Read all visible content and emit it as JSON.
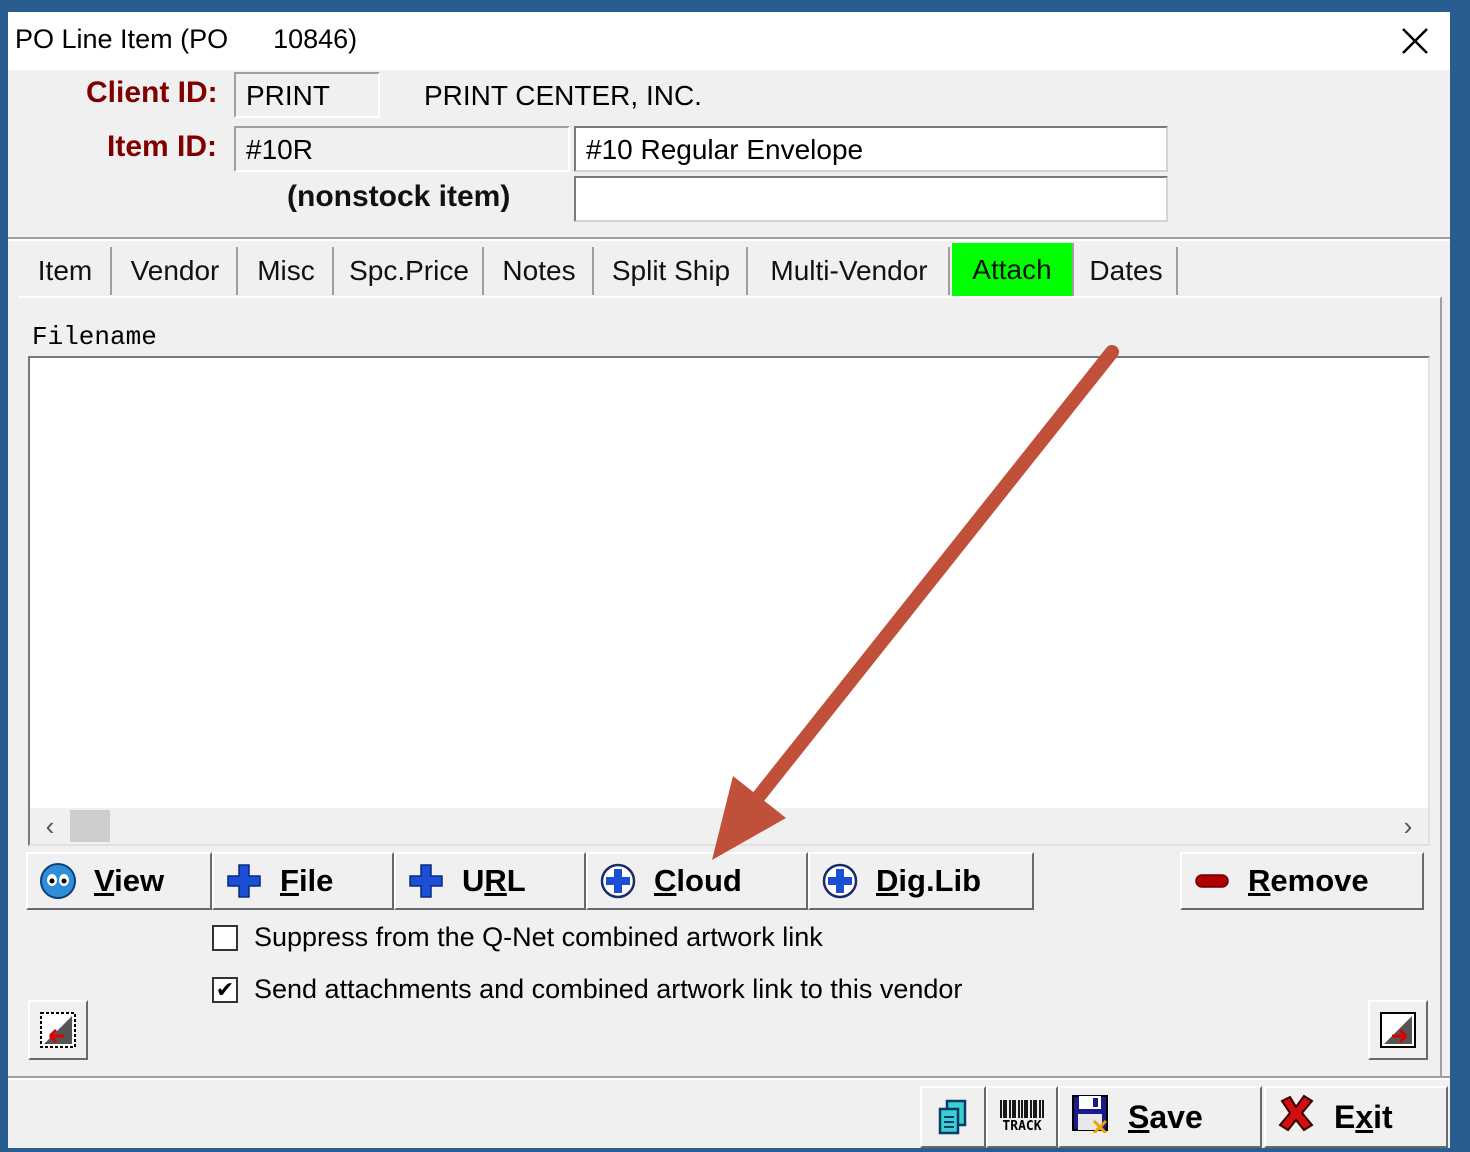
{
  "window": {
    "title": "PO Line Item (PO      10846)"
  },
  "header": {
    "client_label": "Client ID:",
    "client_id": "PRINT",
    "client_name": "PRINT CENTER, INC.",
    "item_label": "Item ID:",
    "item_id": "#10R",
    "item_desc": "#10 Regular Envelope",
    "nonstock_label": "(nonstock item)",
    "nonstock_value": ""
  },
  "tabs": [
    {
      "label": "Item"
    },
    {
      "label": "Vendor"
    },
    {
      "label": "Misc"
    },
    {
      "label": "Spc.Price"
    },
    {
      "label": "Notes"
    },
    {
      "label": "Split Ship"
    },
    {
      "label": "Multi-Vendor"
    },
    {
      "label": "Attach",
      "active": true
    },
    {
      "label": "Dates"
    }
  ],
  "attach": {
    "filename_header": "Filename",
    "files": [],
    "buttons": {
      "view": {
        "pre": "",
        "ul": "V",
        "post": "iew"
      },
      "file": {
        "pre": "",
        "ul": "F",
        "post": "ile"
      },
      "url": {
        "pre": "U",
        "ul": "R",
        "post": "L"
      },
      "cloud": {
        "pre": "",
        "ul": "C",
        "post": "loud"
      },
      "diglib": {
        "pre": "",
        "ul": "D",
        "post": "ig.Lib"
      },
      "remove": {
        "pre": "",
        "ul": "R",
        "post": "emove"
      }
    },
    "suppress_label": "Suppress from the Q-Net combined artwork link",
    "suppress_checked": false,
    "send_label": "Send attachments and combined artwork link to this vendor",
    "send_checked": true
  },
  "footer": {
    "track_label": "TRACK",
    "save": {
      "pre": "",
      "ul": "S",
      "post": "ave"
    },
    "exit": {
      "pre": "E",
      "ul": "x",
      "post": "it"
    }
  },
  "colors": {
    "active_tab": "#00ff00",
    "label_red": "#800000",
    "annotation_arrow": "#c0503a"
  }
}
